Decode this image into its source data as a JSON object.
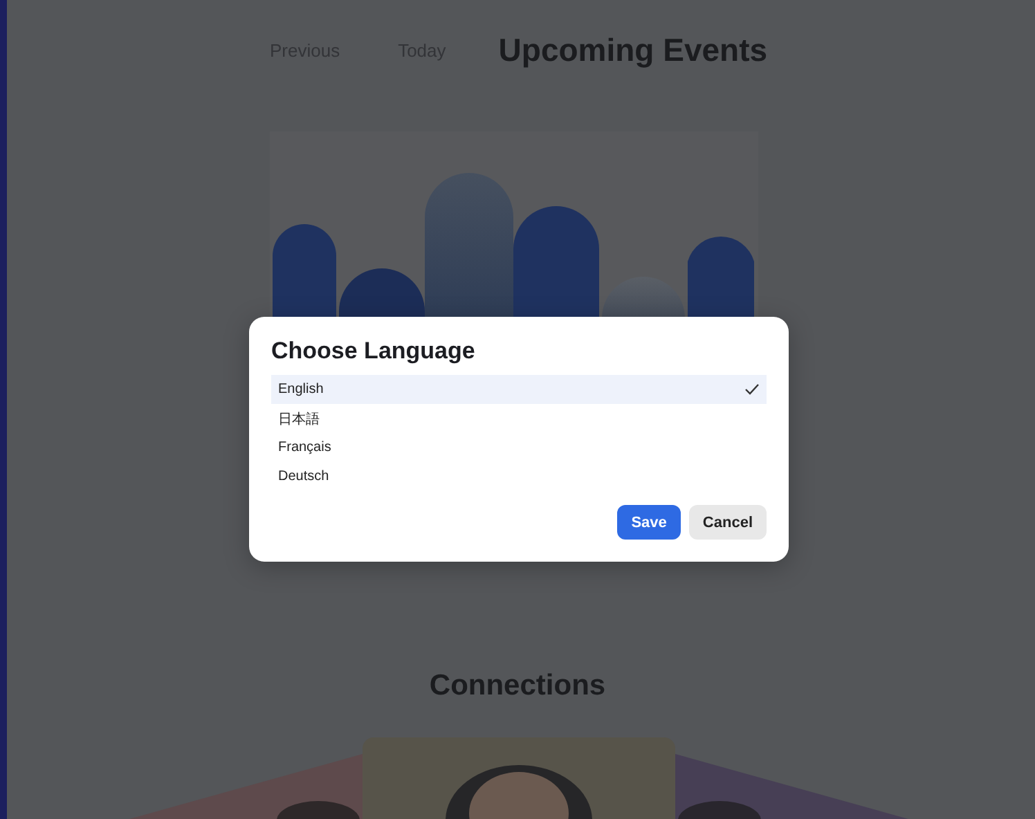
{
  "nav": {
    "links": [
      {
        "label": "Previous"
      },
      {
        "label": "Today"
      }
    ],
    "title": "Upcoming Events"
  },
  "dialog": {
    "title": "Choose Language",
    "options": [
      {
        "label": "English",
        "selected": true
      },
      {
        "label": "日本語",
        "selected": false
      },
      {
        "label": "Français",
        "selected": false
      },
      {
        "label": "Deutsch",
        "selected": false
      }
    ],
    "buttons": [
      {
        "label": "Save",
        "kind": "primary"
      },
      {
        "label": "Cancel",
        "kind": "secondary"
      }
    ]
  },
  "connections": {
    "title": "Connections"
  }
}
